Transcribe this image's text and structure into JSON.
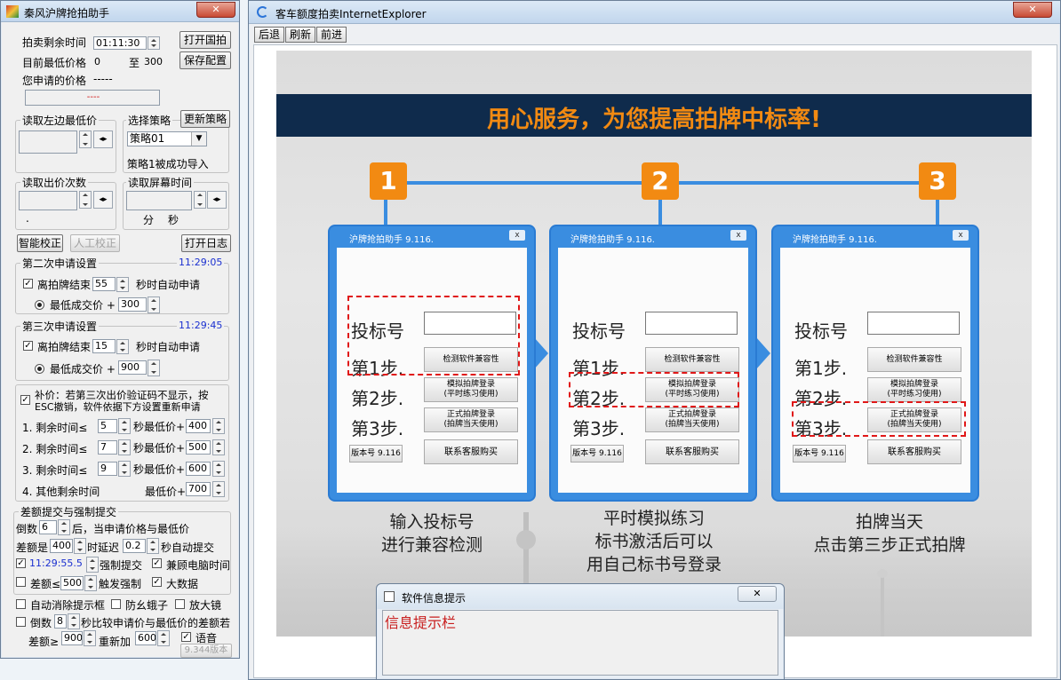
{
  "left_panel": {
    "title": "秦风沪牌抢拍助手",
    "time_label": "拍卖剩余时间",
    "time_value": "01:11:30",
    "open_guopai": "打开国拍",
    "min_price_label": "目前最低价格",
    "min_price_from": "0",
    "min_price_to_label": "至",
    "min_price_to": "300",
    "save_config": "保存配置",
    "your_price_label": "您申请的价格",
    "your_price_value": "-----",
    "your_price_field": "----",
    "read_left_label": "读取左边最低价",
    "strategy_label": "选择策略",
    "update_strategy": "更新策略",
    "strategy_selected": "策略01",
    "strategy_status": "策略1被成功导入",
    "read_bid_count_label": "读取出价次数",
    "read_screen_time_label": "读取屏幕时间",
    "bid_count_dot": ".",
    "min_label": "分",
    "sec_label": "秒",
    "smart_calib": "智能校正",
    "manual_calib": "人工校正",
    "open_log": "打开日志",
    "second_title": "第二次申请设置",
    "second_time": "11:29:05",
    "second_end_label": "离拍牌结束",
    "second_end_val": "55",
    "second_auto_label": "秒时自动申请",
    "second_radio_label": "最低成交价 +",
    "second_plus_val": "300",
    "third_title": "第三次申请设置",
    "third_time": "11:29:45",
    "third_end_label": "离拍牌结束",
    "third_end_val": "15",
    "third_auto_label": "秒时自动申请",
    "third_radio_label": "最低成交价 +",
    "third_plus_val": "900",
    "supplement_line1": "补价：若第三次出价验证码不显示，按",
    "supplement_line2": "ESC撤销，软件依据下方设置重新申请",
    "rows": [
      {
        "label": "1. 剩余时间≤",
        "sec": "5",
        "mid": "秒最低价+",
        "price": "400"
      },
      {
        "label": "2. 剩余时间≤",
        "sec": "7",
        "mid": "秒最低价+",
        "price": "500"
      },
      {
        "label": "3. 剩余时间≤",
        "sec": "9",
        "mid": "秒最低价+",
        "price": "600"
      }
    ],
    "row4_label": "4. 其他剩余时间",
    "row4_mid": "最低价+",
    "row4_price": "700",
    "diff_title": "差额提交与强制提交",
    "countdown_label": "倒数",
    "countdown_val": "6",
    "countdown_after": "后，当申请价格与最低价",
    "diff_label": "差额是",
    "diff_val": "400",
    "delay_label": "时延迟",
    "delay_val": "0.2",
    "auto_submit_label": "秒自动提交",
    "force_time": "11:29:55.5",
    "force_label": "强制提交",
    "compat_label": "兼顾电脑时间",
    "diff_le_label": "差额≤",
    "diff_le_val": "500",
    "trigger_label": "触发强制",
    "bigdata_label": "大数据",
    "auto_clear_label": "自动消除提示框",
    "anti_bug_label": "防幺蛾子",
    "magnifier_label": "放大镜",
    "countdown2_label": "倒数",
    "countdown2_val": "8",
    "compare_label": "秒比较申请价与最低价的差额若",
    "diff_gt_label": "差额≥",
    "diff_gt_val": "900",
    "readd_label": "重新加",
    "readd_val": "600",
    "voice_label": "语音",
    "version": "9.344版本"
  },
  "browser": {
    "title": "客车额度拍卖InternetExplorer",
    "back": "后退",
    "refresh": "刷新",
    "forward": "前进",
    "banner_title": "用心服务，为您提高拍牌中标率!",
    "steps": [
      "1",
      "2",
      "3"
    ],
    "mini_title": "沪牌抢拍助手 9.116.",
    "mini_close": "x",
    "bid_no_label": "投标号",
    "step1": "第1步.",
    "step2": "第2步.",
    "step3": "第3步.",
    "btn_check": "检测软件兼容性",
    "btn_sim_line1": "模拟拍牌登录",
    "btn_sim_line2": "(平时练习使用)",
    "btn_real_line1": "正式拍牌登录",
    "btn_real_line2": "(拍牌当天使用)",
    "version_btn": "版本号 9.116",
    "contact_btn": "联系客服购买",
    "captions": [
      [
        "输入投标号",
        "进行兼容检测"
      ],
      [
        "平时模拟练习",
        "标书激活后可以",
        "用自己标书号登录"
      ],
      [
        "拍牌当天",
        "点击第三步正式拍牌"
      ]
    ]
  },
  "info_window": {
    "title": "软件信息提示",
    "content": "信息提示栏"
  },
  "colors": {
    "banner_bg": "#0f2b4c",
    "banner_text": "#f28a12",
    "step_orange": "#f28a12",
    "accent_blue": "#3a8de0",
    "dash_red": "#e01818"
  }
}
